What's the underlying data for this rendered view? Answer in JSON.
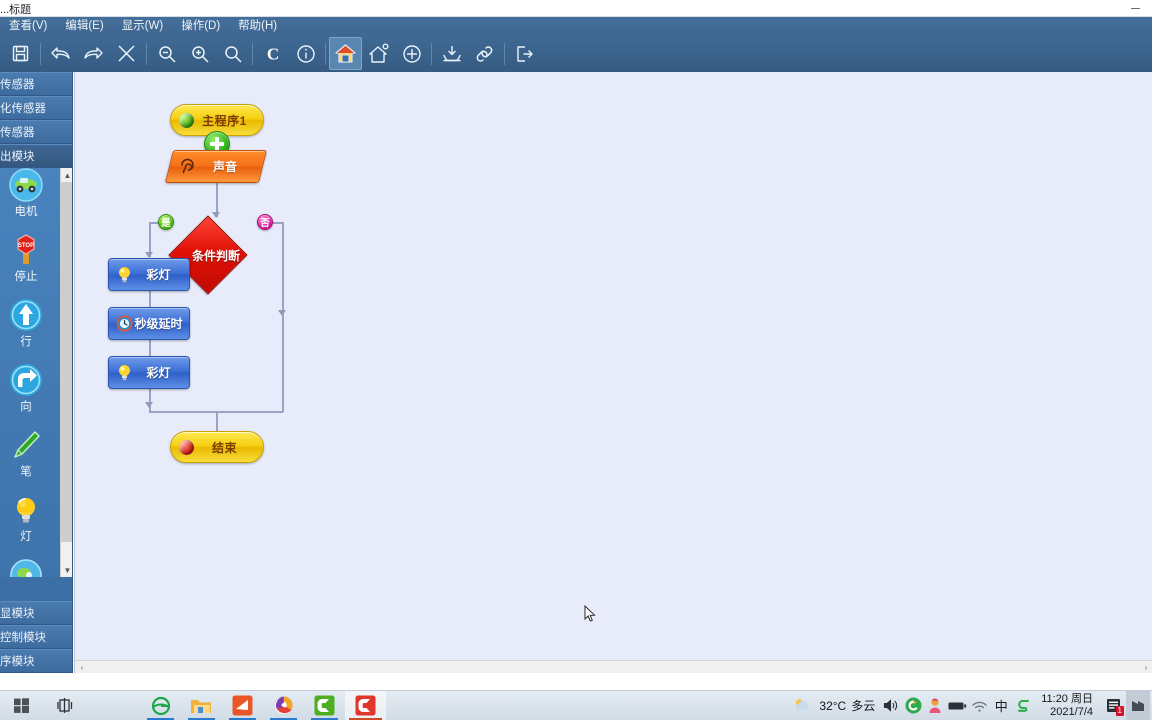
{
  "window": {
    "title": "...标题",
    "minimize_label": "minimize"
  },
  "menubar": {
    "items": [
      {
        "label": "查看(V)",
        "name": "menu-view"
      },
      {
        "label": "编辑(E)",
        "name": "menu-edit"
      },
      {
        "label": "显示(W)",
        "name": "menu-display"
      },
      {
        "label": "操作(D)",
        "name": "menu-operation"
      },
      {
        "label": "帮助(H)",
        "name": "menu-help"
      }
    ]
  },
  "toolbar": {
    "buttons": [
      {
        "icon": "save-icon",
        "tip": "保存"
      },
      {
        "icon": "undo-icon",
        "tip": "撤销"
      },
      {
        "icon": "redo-icon",
        "tip": "重做"
      },
      {
        "icon": "delete-x-icon",
        "tip": "删除"
      },
      {
        "icon": "zoom-out-icon",
        "tip": "缩小"
      },
      {
        "icon": "zoom-in-icon",
        "tip": "放大"
      },
      {
        "icon": "zoom-reset-icon",
        "tip": "原始大小"
      },
      {
        "icon": "compile-c-icon",
        "tip": "编译"
      },
      {
        "icon": "info-icon",
        "tip": "信息"
      },
      {
        "icon": "home-icon",
        "tip": "主程序"
      },
      {
        "icon": "subroutine-icon",
        "tip": "子程序"
      },
      {
        "icon": "add-circle-icon",
        "tip": "添加"
      },
      {
        "icon": "download-icon",
        "tip": "下载"
      },
      {
        "icon": "link-icon",
        "tip": "连接"
      },
      {
        "icon": "exit-icon",
        "tip": "退出"
      }
    ]
  },
  "sidebar": {
    "categories_top": [
      {
        "label": "传感器",
        "selected": false
      },
      {
        "label": "化传感器",
        "selected": false
      },
      {
        "label": "传感器",
        "selected": false
      },
      {
        "label": "出模块",
        "selected": true
      }
    ],
    "categories_bottom": [
      {
        "label": "显模块",
        "selected": false
      },
      {
        "label": "控制模块",
        "selected": false
      },
      {
        "label": "序模块",
        "selected": false
      }
    ],
    "palette_items": [
      {
        "label": "电机",
        "icon": "motor-icon"
      },
      {
        "label": "停止",
        "icon": "stop-sign-icon"
      },
      {
        "label": "行",
        "icon": "forward-arrow-icon"
      },
      {
        "label": "向",
        "icon": "turn-arrow-icon"
      },
      {
        "label": "笔",
        "icon": "pen-icon"
      },
      {
        "label": "灯",
        "icon": "lamp-icon"
      },
      {
        "label": "",
        "icon": "circle-icon"
      }
    ],
    "scroll_up": "▲",
    "scroll_down": "▼"
  },
  "flowchart": {
    "nodes": [
      {
        "id": "start",
        "type": "terminator",
        "label": "主程序1",
        "dot": "green"
      },
      {
        "id": "plus",
        "type": "add-button",
        "label": "+"
      },
      {
        "id": "sound",
        "type": "io",
        "label": "声音",
        "icon": "ear-icon"
      },
      {
        "id": "cond",
        "type": "decision",
        "label": "条件判断",
        "yes": "是",
        "no": "否"
      },
      {
        "id": "lamp1",
        "type": "process",
        "label": "彩灯",
        "icon": "lamp-icon"
      },
      {
        "id": "delay",
        "type": "process",
        "label": "秒级延时",
        "icon": "clock-icon"
      },
      {
        "id": "lamp2",
        "type": "process",
        "label": "彩灯",
        "icon": "lamp-icon"
      },
      {
        "id": "end",
        "type": "terminator",
        "label": "结束",
        "dot": "red"
      }
    ]
  },
  "canvas": {
    "scroll_left": "‹",
    "scroll_right": "›"
  },
  "taskbar": {
    "start_label": "start",
    "task_view_label": "task-view",
    "apps": [
      {
        "name": "internet-explorer",
        "letter": "e"
      },
      {
        "name": "file-explorer",
        "letter": ""
      },
      {
        "name": "media-app",
        "letter": ""
      },
      {
        "name": "browser-app",
        "letter": ""
      },
      {
        "name": "green-c-app",
        "letter": "C"
      },
      {
        "name": "red-c-app",
        "letter": "C",
        "active": true
      }
    ],
    "weather": {
      "temp": "32°C",
      "condition": "多云"
    },
    "tray_icons": [
      "volume-icon",
      "shield-icon",
      "user-icon",
      "battery-icon",
      "wifi-icon",
      "ime-icon",
      "sogou-icon"
    ],
    "ime_label": "中",
    "clock": {
      "time": "11:20 周日",
      "date": "2021/7/4"
    },
    "notification_count": "1"
  },
  "colors": {
    "titlebar_menu": "#3f6791",
    "toolbar": "#3f6a95",
    "sidebar": "#3c6fa5",
    "canvas_bg": "#e8ecfa",
    "accent_yellow": "#f5cf12",
    "accent_orange": "#f4701a",
    "accent_blue": "#3c6fd6",
    "accent_red": "#e01107",
    "taskbar": "#d9e2ec"
  }
}
